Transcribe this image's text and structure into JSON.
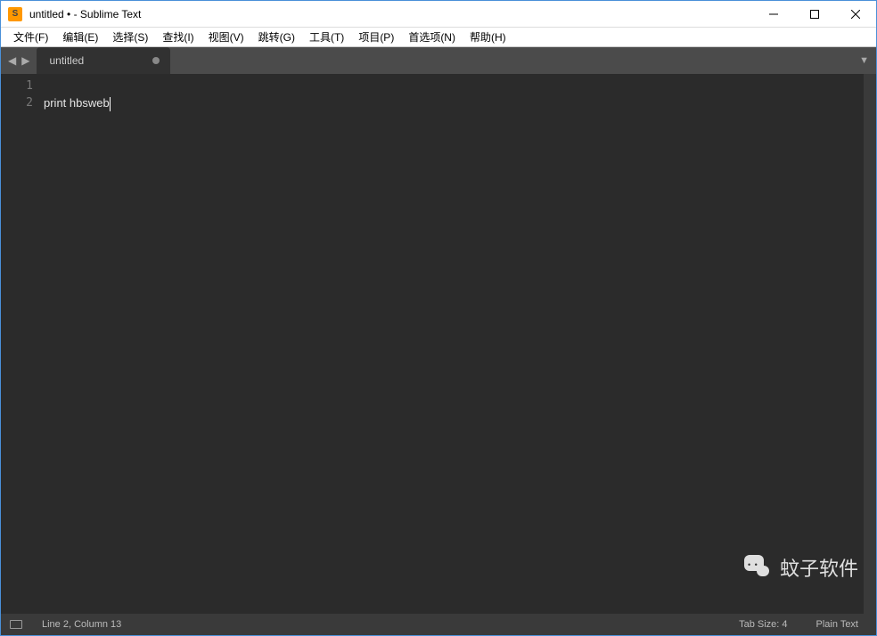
{
  "titlebar": {
    "title": "untitled • - Sublime Text"
  },
  "menubar": {
    "items": [
      {
        "label": "文件(F)",
        "u": "F"
      },
      {
        "label": "编辑(E)",
        "u": "E"
      },
      {
        "label": "选择(S)",
        "u": "S"
      },
      {
        "label": "查找(I)",
        "u": "I"
      },
      {
        "label": "视图(V)",
        "u": "V"
      },
      {
        "label": "跳转(G)",
        "u": "G"
      },
      {
        "label": "工具(T)",
        "u": "T"
      },
      {
        "label": "项目(P)",
        "u": "P"
      },
      {
        "label": "首选项(N)",
        "u": "N"
      },
      {
        "label": "帮助(H)",
        "u": "H"
      }
    ]
  },
  "tabs": {
    "active": {
      "label": "untitled",
      "dirty": true
    }
  },
  "editor": {
    "lines": [
      {
        "num": "1",
        "text": ""
      },
      {
        "num": "2",
        "text": "print hbsweb"
      }
    ],
    "active_line": 2
  },
  "statusbar": {
    "position": "Line 2, Column 13",
    "tab_size": "Tab Size: 4",
    "syntax": "Plain Text"
  },
  "watermark": {
    "text": "蚊子软件"
  }
}
